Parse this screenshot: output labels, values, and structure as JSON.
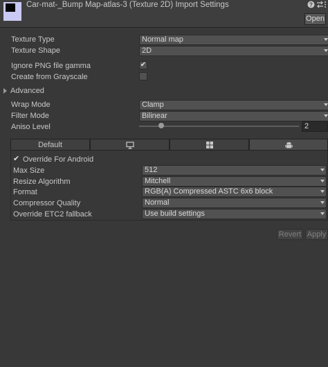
{
  "header": {
    "title": "Car-mat-_Bump Map-atlas-3 (Texture 2D) Import Settings",
    "open_label": "Open",
    "icons": [
      "help-icon",
      "preset-icon",
      "more-icon"
    ]
  },
  "settings": {
    "texture_type": {
      "label": "Texture Type",
      "value": "Normal map"
    },
    "texture_shape": {
      "label": "Texture Shape",
      "value": "2D"
    },
    "ignore_png_gamma": {
      "label": "Ignore PNG file gamma",
      "checked": true,
      "glyph": "✔"
    },
    "create_from_grayscale": {
      "label": "Create from Grayscale",
      "checked": false
    },
    "advanced": {
      "label": "Advanced"
    },
    "wrap_mode": {
      "label": "Wrap Mode",
      "value": "Clamp"
    },
    "filter_mode": {
      "label": "Filter Mode",
      "value": "Bilinear"
    },
    "aniso_level": {
      "label": "Aniso Level",
      "value": "2"
    }
  },
  "platform_tabs": [
    {
      "label": "Default",
      "icon": ""
    },
    {
      "label": "",
      "icon": "monitor-icon"
    },
    {
      "label": "",
      "icon": "windows-icon"
    },
    {
      "label": "",
      "icon": "android-icon"
    }
  ],
  "platform": {
    "override": {
      "label": "Override For Android",
      "checked": true,
      "glyph": "✔"
    },
    "max_size": {
      "label": "Max Size",
      "value": "512"
    },
    "resize_algorithm": {
      "label": "Resize Algorithm",
      "value": "Mitchell"
    },
    "format": {
      "label": "Format",
      "value": "RGB(A) Compressed ASTC 6x6 block"
    },
    "compressor_quality": {
      "label": "Compressor Quality",
      "value": "Normal"
    },
    "override_etc2": {
      "label": "Override ETC2 fallback",
      "value": "Use build settings"
    }
  },
  "footer": {
    "revert_label": "Revert",
    "apply_label": "Apply"
  },
  "colors": {
    "background": "#383838",
    "header": "#3e3e3e",
    "field": "#515151",
    "text": "#c8c8c8"
  }
}
